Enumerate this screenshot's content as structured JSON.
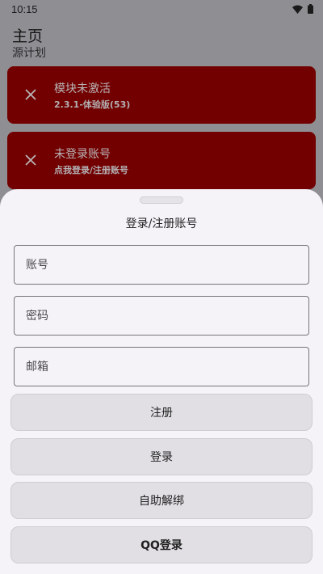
{
  "status_bar": {
    "time": "10:15",
    "icons": [
      "wifi-icon",
      "battery-icon"
    ]
  },
  "app": {
    "title": "主页",
    "subtitle": "源计划"
  },
  "cards": [
    {
      "icon": "close-icon",
      "title": "模块未激活",
      "subtitle": "2.3.1-体验版(53)"
    },
    {
      "icon": "close-icon",
      "title": "未登录账号",
      "subtitle": "点我登录/注册账号"
    }
  ],
  "sheet": {
    "title": "登录/注册账号",
    "fields": {
      "account_placeholder": "账号",
      "password_placeholder": "密码",
      "email_placeholder": "邮箱"
    },
    "buttons": {
      "register": "注册",
      "login": "登录",
      "unbind": "自助解绑",
      "qq_login": "QQ登录"
    }
  },
  "colors": {
    "card_background": "#720000",
    "sheet_background": "#f6f3f8",
    "scrim": "#8f8e93",
    "button_background": "#e1dfe4"
  }
}
